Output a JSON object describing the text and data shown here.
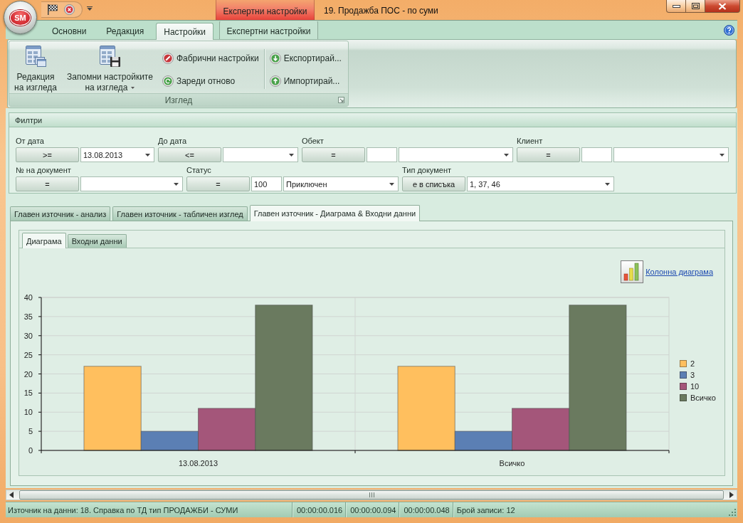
{
  "window": {
    "title": "19. Продажба ПОС - по суми",
    "contextual_tab_group": "Експертни настройки"
  },
  "app_button": {
    "label": "SM"
  },
  "ribbon": {
    "tabs": [
      {
        "label": "Основни",
        "selected": false,
        "contextual": false
      },
      {
        "label": "Редакция",
        "selected": false,
        "contextual": false
      },
      {
        "label": "Настройки",
        "selected": true,
        "contextual": false
      },
      {
        "label": "Експертни настройки",
        "selected": false,
        "contextual": true
      }
    ],
    "groups": [
      {
        "label": "Изглед",
        "large_buttons": [
          {
            "lines": [
              "Редакция",
              "на изгледа"
            ],
            "dropdown": false
          },
          {
            "lines": [
              "Запомни настройките",
              "на изгледа"
            ],
            "dropdown": true
          }
        ],
        "small_buttons": [
          {
            "label": "Фабрични настройки"
          },
          {
            "label": "Зареди отново"
          },
          {
            "label": "Експортирай..."
          },
          {
            "label": "Импортирай..."
          }
        ]
      }
    ]
  },
  "filters": {
    "title": "Филтри",
    "fields": [
      {
        "label": "От дата",
        "operator": ">=",
        "kind": "combo",
        "value": "13.08.2013"
      },
      {
        "label": "До дата",
        "operator": "<=",
        "kind": "combo"
      },
      {
        "label": "Обект",
        "operator": "=",
        "kind": "text_combo"
      },
      {
        "label": "Клиент",
        "operator": "=",
        "kind": "text_combo"
      },
      {
        "label": "№ на документ",
        "operator": "=",
        "kind": "combo"
      },
      {
        "label": "Статус",
        "operator": "=",
        "kind": "text_combo",
        "text": "100",
        "value": "Приключен"
      },
      {
        "label": "Тип документ",
        "operator": "е в списъка",
        "kind": "combo",
        "value": "1, 37, 46"
      }
    ]
  },
  "view_tabs": [
    {
      "label": "Главен източник - анализ",
      "selected": false
    },
    {
      "label": "Главен източник - табличен изглед",
      "selected": false
    },
    {
      "label": "Главен източник - Диаграма & Входни данни",
      "selected": true
    }
  ],
  "chart_panel": {
    "tabs": [
      {
        "label": "Диаграма",
        "selected": true
      },
      {
        "label": "Входни данни",
        "selected": false
      }
    ],
    "type_link": "Колонна диаграма",
    "chart_data": {
      "type": "bar",
      "categories": [
        "13.08.2013",
        "Всичко"
      ],
      "series": [
        {
          "name": "2",
          "color": "#ffbf5e",
          "values": [
            22,
            22
          ]
        },
        {
          "name": "3",
          "color": "#5b7fb4",
          "values": [
            5,
            5
          ]
        },
        {
          "name": "10",
          "color": "#a4567a",
          "values": [
            11,
            11
          ]
        },
        {
          "name": "Всичко",
          "color": "#6a7a5f",
          "values": [
            38,
            38
          ]
        }
      ],
      "ylim": [
        0,
        40
      ],
      "yticks": [
        0,
        5,
        10,
        15,
        20,
        25,
        30,
        35,
        40
      ],
      "grid": true,
      "legend": true
    }
  },
  "status_bar": {
    "panels": [
      {
        "kind": "source",
        "text": "Източник на данни: 18. Справка по ТД тип ПРОДАЖБИ - СУМИ"
      },
      {
        "kind": "timing",
        "text": "00:00:00.016"
      },
      {
        "kind": "timing",
        "text": "00:00:00.094"
      },
      {
        "kind": "timing",
        "text": "00:00:00.048"
      },
      {
        "kind": "count",
        "text": "Брой записи: 12"
      }
    ]
  }
}
